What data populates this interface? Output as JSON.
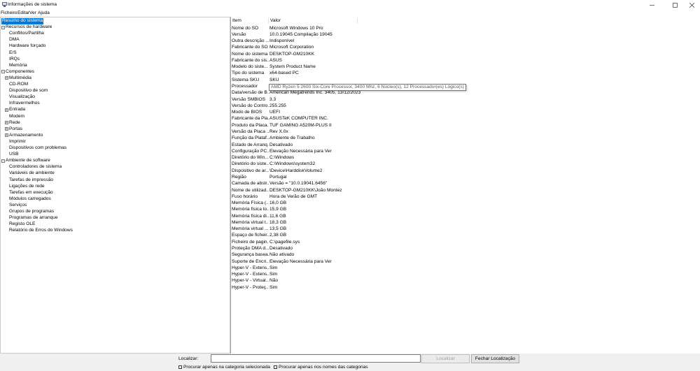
{
  "window": {
    "title": "Informações de sistema",
    "icon": "system-information-icon"
  },
  "menu": [
    "Ficheiro",
    "Editar",
    "Ver",
    "Ajuda"
  ],
  "tree": {
    "root": "Resumo do sistema",
    "hardware": {
      "label": "Recursos de hardware",
      "children": [
        "Conflitos/Partilha",
        "DMA",
        "Hardware forçado",
        "E/S",
        "IRQs",
        "Memória"
      ]
    },
    "components": {
      "label": "Componentes",
      "children": [
        "Multimédia",
        "CD-ROM",
        "Dispositivo de som",
        "Visualização",
        "Infravermelhos",
        "Entrada",
        "Modem",
        "Rede",
        "Portas",
        "Armazenamento",
        "Imprimir",
        "Dispositivos com problemas",
        "USB"
      ]
    },
    "software": {
      "label": "Ambiente de software",
      "children": [
        "Controladores de sistema",
        "Variáveis de ambiente",
        "Tarefas de impressão",
        "Ligações de rede",
        "Tarefas em execução",
        "Módulos carregados",
        "Serviços",
        "Grupos de programas",
        "Programas de arranque",
        "Registo OLE",
        "Relatório de Erros do Windows"
      ]
    }
  },
  "table": {
    "headers": {
      "item": "Item",
      "value": "Valor"
    },
    "rows": [
      {
        "item": "Nome do SO",
        "value": "Microsoft Windows 10 Pro"
      },
      {
        "item": "Versão",
        "value": "10.0.19045 Compilação 19045"
      },
      {
        "item": "Outra descrição ...",
        "value": "Indisponível"
      },
      {
        "item": "Fabricante do SO",
        "value": "Microsoft Corporation"
      },
      {
        "item": "Nome do sistema",
        "value": "DESKTOP-GM210KK"
      },
      {
        "item": "Fabricante do sis...",
        "value": "ASUS"
      },
      {
        "item": "Modelo do siste...",
        "value": "System Product Name"
      },
      {
        "item": "Tipo do sistema",
        "value": "x64-based PC"
      },
      {
        "item": "Sistema SKU",
        "value": "SKU"
      },
      {
        "item": "Processador",
        "value": "AMD Ryzen 5 2600 Six-Core Processor, 3400 Mhz, 6 Núcleo(s), 12 Processador(es) Lógico(s)"
      },
      {
        "item": "Data/versão de B...",
        "value": "American Megatrends Inc. 3405, 13/12/2023"
      },
      {
        "item": "Versão SMBIOS",
        "value": "3.3"
      },
      {
        "item": "Versão do Contro...",
        "value": "255.255"
      },
      {
        "item": "Modo de BIOS",
        "value": "UEFI"
      },
      {
        "item": "Fabricante da Pla...",
        "value": "ASUSTeK COMPUTER INC."
      },
      {
        "item": "Produto da Placa...",
        "value": "TUF GAMING A520M-PLUS II"
      },
      {
        "item": "Versão da Placa ...",
        "value": "Rev X.0x"
      },
      {
        "item": "Função da Plataf...",
        "value": "Ambiente de Trabalho"
      },
      {
        "item": "Estado de Arranq...",
        "value": "Desativado"
      },
      {
        "item": "Configuração PC...",
        "value": "Elevação Necessária para Ver"
      },
      {
        "item": "Diretório do Win...",
        "value": "C:\\Windows"
      },
      {
        "item": "Diretório do siste...",
        "value": "C:\\Windows\\system32"
      },
      {
        "item": "Dispositivo de ar...",
        "value": "\\Device\\HarddiskVolume2"
      },
      {
        "item": "Região",
        "value": "Portugal"
      },
      {
        "item": "Camada de abstr...",
        "value": "Versão = \"10.0.19041.6456\""
      },
      {
        "item": "Nome de utilizad...",
        "value": "DESKTOP-GM210KK\\João Montez"
      },
      {
        "item": "Fuso horário",
        "value": "Hora de Verão de GMT"
      },
      {
        "item": "Memória Física (...",
        "value": "16,0 GB"
      },
      {
        "item": "Memória física to...",
        "value": "15,9 GB"
      },
      {
        "item": "Memória física di...",
        "value": "11,6 GB"
      },
      {
        "item": "Memória virtual t...",
        "value": "18,3 GB"
      },
      {
        "item": "Memória virtual ...",
        "value": "13,5 GB"
      },
      {
        "item": "Espaço de ficheir...",
        "value": "2,38 GB"
      },
      {
        "item": "Ficheiro de pagin...",
        "value": "C:\\pagefile.sys"
      },
      {
        "item": "Proteção DMA d...",
        "value": "Desativado"
      },
      {
        "item": "Segurança basea...",
        "value": "Não ativado"
      },
      {
        "item": "Suporte de Encri...",
        "value": "Elevação Necessária para Ver"
      },
      {
        "item": "Hyper-V - Extens...",
        "value": "Sim"
      },
      {
        "item": "Hyper-V - Extens...",
        "value": "Sim"
      },
      {
        "item": "Hyper-V - Virtual...",
        "value": "Não"
      },
      {
        "item": "Hyper-V - Proteç...",
        "value": "Sim"
      }
    ],
    "tooltip": "AMD Ryzen 5 2600 Six-Core Processor, 3400 Mhz, 6 Núcleo(s), 12 Processador(es) Lógico(s)"
  },
  "search": {
    "label": "Localizar:",
    "value": "",
    "find_button": "Localizar",
    "close_button": "Fechar Localização",
    "option_selected": "Procurar apenas na categoria selecionada",
    "option_names": "Procurar apenas nos nomes das categorias"
  },
  "colors": {
    "selection": "#0078d7"
  }
}
